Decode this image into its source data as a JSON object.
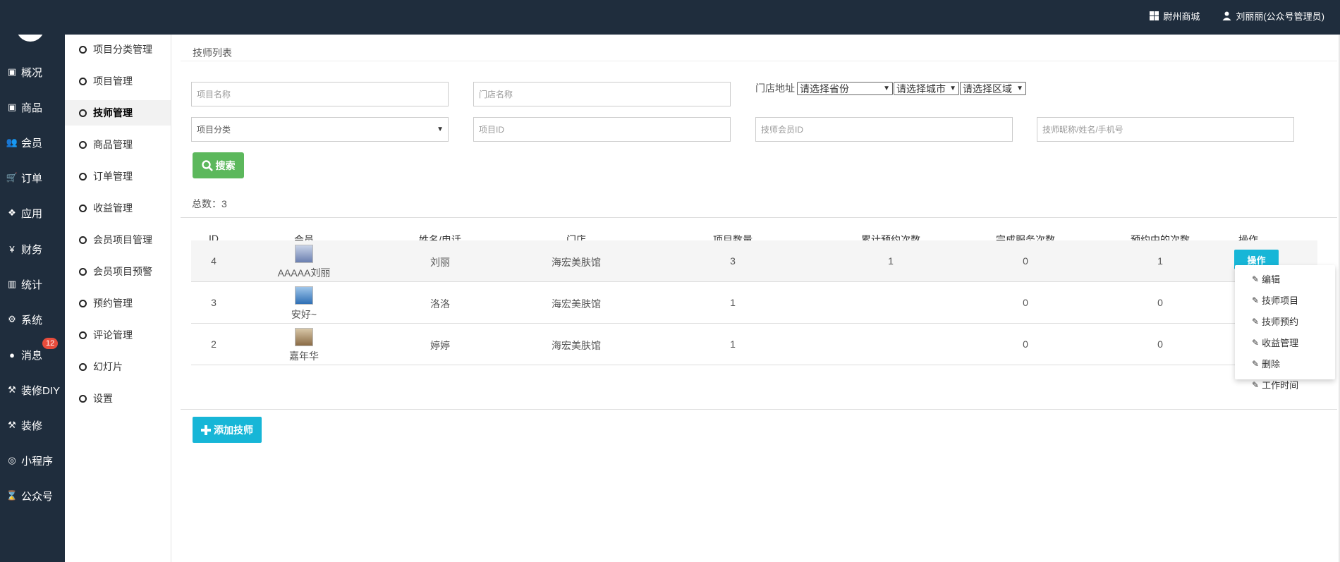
{
  "header": {
    "store_label": "尉州商城",
    "user_label": "刘丽丽(公众号管理员)"
  },
  "nav": {
    "items": [
      {
        "label": "概况",
        "icon": "monitor-icon"
      },
      {
        "label": "商品",
        "icon": "box-icon"
      },
      {
        "label": "会员",
        "icon": "users-icon"
      },
      {
        "label": "订单",
        "icon": "cart-icon"
      },
      {
        "label": "应用",
        "icon": "cubes-icon"
      },
      {
        "label": "财务",
        "icon": "yen-icon"
      },
      {
        "label": "统计",
        "icon": "bar-chart-icon"
      },
      {
        "label": "系统",
        "icon": "gears-icon"
      },
      {
        "label": "消息",
        "icon": "chat-icon",
        "badge": "12"
      },
      {
        "label": "装修DIY",
        "icon": "hammer-icon"
      },
      {
        "label": "装修",
        "icon": "hammer-icon"
      },
      {
        "label": "小程序",
        "icon": "wechat-icon"
      },
      {
        "label": "公众号",
        "icon": "hourglass-icon"
      }
    ]
  },
  "subnav": {
    "items": [
      "项目分类管理",
      "项目管理",
      "技师管理",
      "商品管理",
      "订单管理",
      "收益管理",
      "会员项目管理",
      "会员项目预警",
      "预约管理",
      "评论管理",
      "幻灯片",
      "设置"
    ],
    "active": "技师管理"
  },
  "page": {
    "title": "技师列表",
    "filters": {
      "project_name_placeholder": "项目名称",
      "store_name_placeholder": "门店名称",
      "address_label": "门店地址",
      "province": "请选择省份",
      "city": "请选择城市",
      "district": "请选择区域",
      "category": "项目分类",
      "project_id_placeholder": "项目ID",
      "member_id_placeholder": "技师会员ID",
      "keyword_placeholder": "技师昵称/姓名/手机号"
    },
    "search_label": "搜索",
    "total_text": "总数：3",
    "add_label": "添加技师"
  },
  "table": {
    "headers": [
      "ID",
      "会员",
      "姓名/电话",
      "门店",
      "项目数量",
      "累计预约次数",
      "完成服务次数",
      "预约中的次数",
      "操作"
    ],
    "rows": [
      {
        "id": "4",
        "member": "AAAAA刘丽",
        "name": "刘丽",
        "store": "海宏美肤馆",
        "projects": "3",
        "total_bookings": "1",
        "completed": "0",
        "pending": "1"
      },
      {
        "id": "3",
        "member": "安好~",
        "name": "洛洛",
        "store": "海宏美肤馆",
        "projects": "1",
        "total_bookings": "",
        "completed": "0",
        "pending": "0"
      },
      {
        "id": "2",
        "member": "嘉年华",
        "name": "婷婷",
        "store": "海宏美肤馆",
        "projects": "1",
        "total_bookings": "",
        "completed": "0",
        "pending": "0"
      }
    ],
    "op_label": "操作",
    "op_menu": [
      "编辑",
      "技师项目",
      "技师预约",
      "收益管理",
      "删除",
      "工作时间"
    ]
  },
  "colors": {
    "sidebar_bg": "#1f2d3d",
    "search_green": "#5cb85c",
    "accent_cyan": "#17b6d7",
    "badge_red": "#e74c3c"
  }
}
